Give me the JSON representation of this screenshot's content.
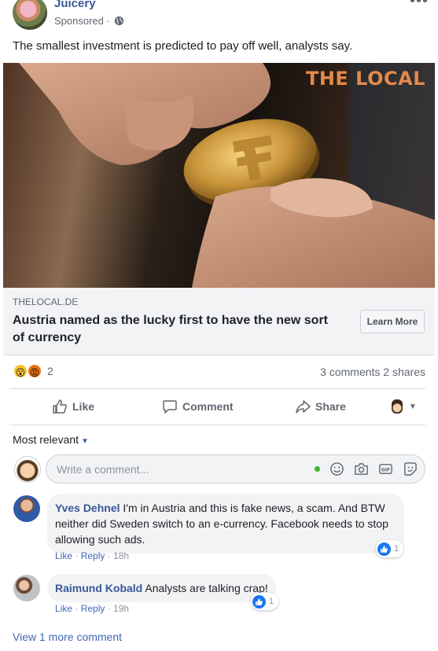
{
  "post": {
    "page_name": "Juicery",
    "sponsored_label": "Sponsored · ",
    "text": "The smallest investment is predicted to pay off well, analysts say.",
    "more_icon": "more-horizontal-icon"
  },
  "link": {
    "image_brand": "THE LOCAL",
    "domain": "THELOCAL.DE",
    "title": "Austria named as the lucky first to have the new sort of currency",
    "cta_label": "Learn More"
  },
  "reactions": {
    "icons": [
      "wow-icon",
      "angry-icon"
    ],
    "count": "2",
    "comments_shares": "3 comments  2 shares"
  },
  "actions": {
    "like_label": "Like",
    "comment_label": "Comment",
    "share_label": "Share"
  },
  "comments_section": {
    "sort_label": "Most relevant",
    "composer_placeholder": "Write a comment...",
    "view_more": "View 1 more comment"
  },
  "comments": [
    {
      "author": "Yves Dehnel",
      "text": "I'm in Austria and this is fake news, a scam. And BTW neither did Sweden switch to an e-currency. Facebook needs to stop allowing such ads.",
      "like_label": "Like",
      "reply_label": "Reply",
      "time": "18h",
      "reaction_count": "1"
    },
    {
      "author": "Raimund Kobald",
      "text": "Analysts are talking crap!",
      "like_label": "Like",
      "reply_label": "Reply",
      "time": "19h",
      "reaction_count": "1"
    }
  ],
  "colors": {
    "link_blue": "#385898",
    "brand_orange": "#e3894b",
    "online_green": "#42b72a",
    "like_blue": "#1877f2"
  }
}
